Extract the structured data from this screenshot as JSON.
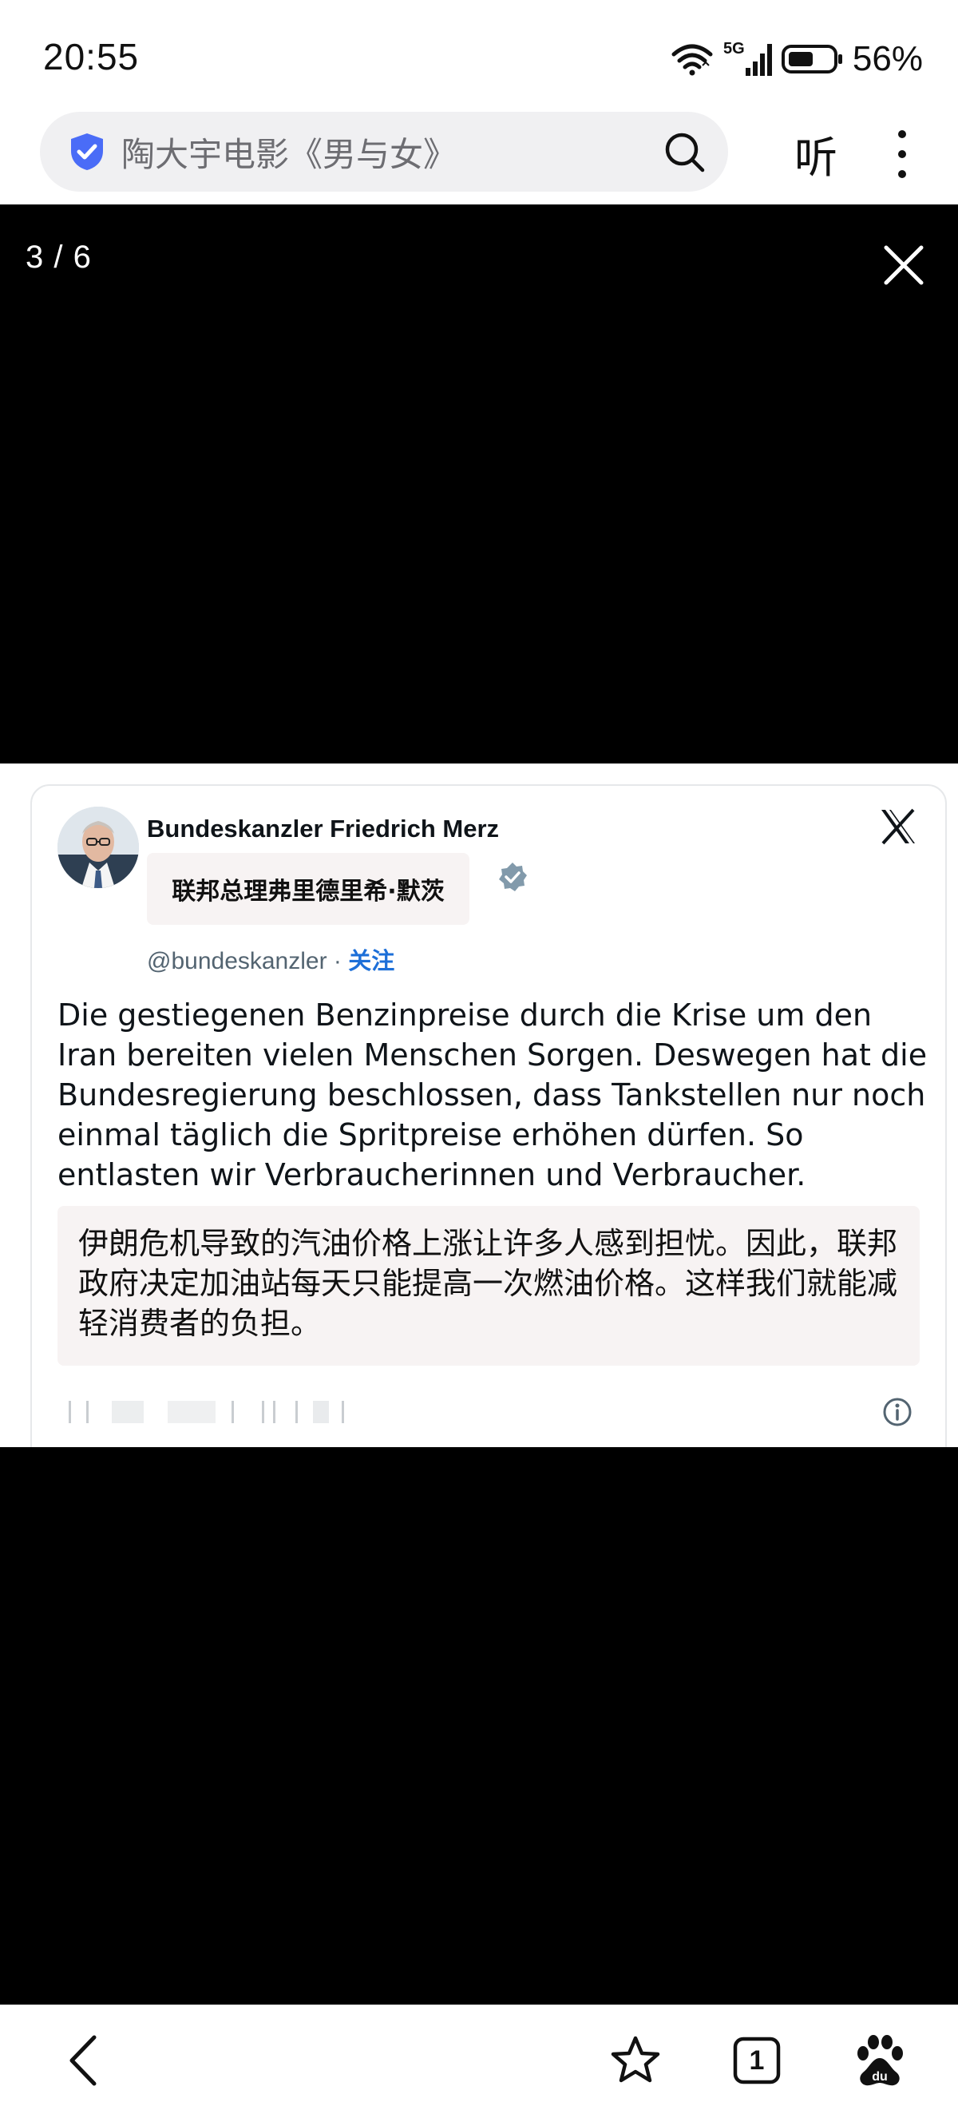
{
  "status_bar": {
    "time": "20:55",
    "network": "5G",
    "battery": "56%",
    "icons": [
      "wifi-icon",
      "signal-icon",
      "battery-icon"
    ]
  },
  "browser": {
    "search_query": "陶大宇电影《男与女》",
    "listen_label": "听",
    "icons": [
      "shield-check-icon",
      "search-icon",
      "more-vertical-icon"
    ],
    "accent": "#4a6cf7"
  },
  "viewer": {
    "counter": "3 / 6",
    "icons": [
      "close-icon"
    ]
  },
  "tweet": {
    "author": "Bundeskanzler Friedrich Merz",
    "author_translation": "联邦总理弗里德里希·默茨",
    "handle": "@bundeskanzler",
    "separator": " · ",
    "follow_label": "关注",
    "text": "Die gestiegenen Benzinpreise durch die Krise um den Iran bereiten vielen Menschen Sorgen. Deswegen hat die Bundesregierung beschlossen, dass Tankstellen nur noch einmal täglich die Spritpreise erhöhen dürfen. So entlasten wir Verbraucherinnen und Verbraucher.",
    "translation": "伊朗危机导致的汽油价格上涨让许多人感到担忧。因此，联邦政府决定加油站每天只能提高一次燃油价格。这样我们就能减轻消费者的负担。",
    "icons": [
      "avatar",
      "verified-badge-icon",
      "x-logo-icon",
      "info-icon"
    ],
    "colors": {
      "link": "#1d6fd8",
      "translation_bg": "#f7f3f3",
      "verified": "#829aab"
    }
  },
  "bottom_nav": {
    "tab_count": "1",
    "icons": [
      "back-arrow-icon",
      "star-icon",
      "tabs-icon",
      "baidu-paw-icon"
    ]
  }
}
